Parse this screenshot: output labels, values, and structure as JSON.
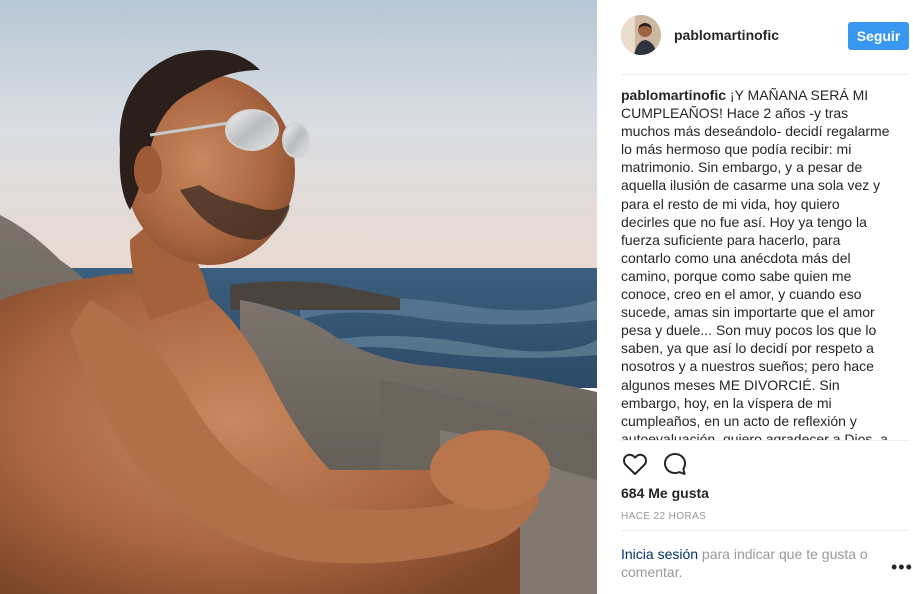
{
  "post": {
    "username": "pablomartinofic",
    "follow_label": "Seguir",
    "caption_text": "¡Y MAÑANA SERÁ MI CUMPLEAÑOS! Hace 2 años -y tras muchos más deseándolo- decidí regalarme lo más hermoso que podía recibir: mi matrimonio. Sin embargo, y a pesar de aquella ilusión de casarme una sola vez y para el resto de mi vida, hoy quiero decirles que no fue así. Hoy ya tengo la fuerza suficiente para hacerlo, para contarlo como una anécdota más del camino, porque como sabe quien me conoce, creo en el amor, y cuando eso sucede, amas sin importarte que el amor pesa y duele... Son muy pocos los que lo saben, ya que así lo decidí por respeto a nosotros y a nuestros sueños; pero hace algunos meses ME DIVORCIÉ. Sin embargo, hoy, en la víspera de mi cumpleaños, en un acto de reflexión y autoevaluación, quiero agradecer a Dios, a la vida y a mi bella ex esposa Yelena, por haberme regalado una",
    "likes": "684 Me gusta",
    "timestamp": "HACE 22 HORAS",
    "login_link": "Inicia sesión",
    "login_rest": " para indicar que te gusta o comentar.",
    "more_options": "•••"
  },
  "icons": {
    "like": "heart-outline-icon",
    "comment": "speech-bubble-icon",
    "more": "ellipsis-icon"
  },
  "colors": {
    "accent": "#3897f0",
    "link": "#003569",
    "muted": "#999999",
    "text": "#262626",
    "divider": "#efefef"
  }
}
